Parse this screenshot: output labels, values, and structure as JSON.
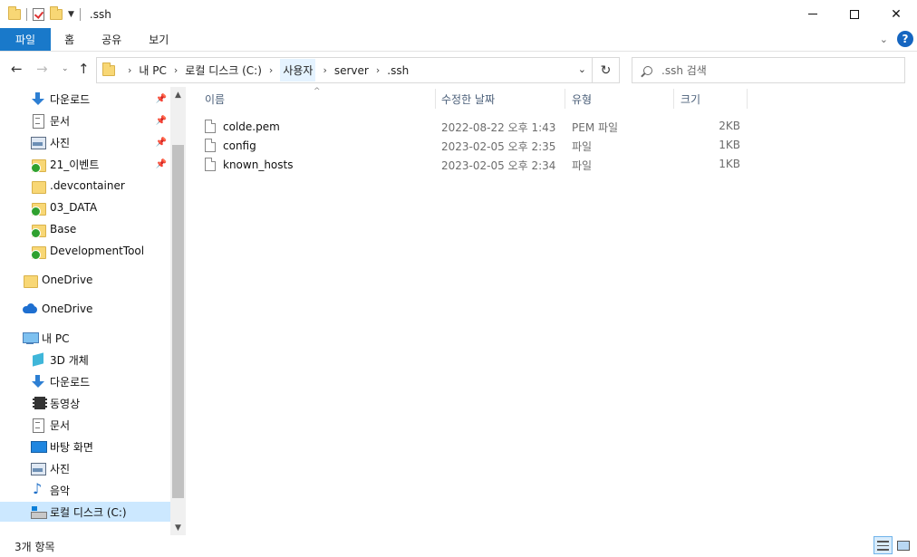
{
  "window": {
    "title": ".ssh",
    "minimize_label": "",
    "close_label": "✕"
  },
  "ribbon": {
    "tabs": [
      "파일",
      "홈",
      "공유",
      "보기"
    ],
    "help_label": "?"
  },
  "address": {
    "crumbs": [
      "내 PC",
      "로컬 디스크 (C:)",
      "사용자",
      "server",
      ".ssh"
    ],
    "search_placeholder": ".ssh 검색"
  },
  "nav": {
    "items": [
      {
        "label": "다운로드",
        "icon": "download-icon",
        "pinned": true
      },
      {
        "label": "문서",
        "icon": "document-icon",
        "pinned": true
      },
      {
        "label": "사진",
        "icon": "picture-icon",
        "pinned": true
      },
      {
        "label": "21_이벤트",
        "icon": "synced-folder-icon",
        "pinned": true
      },
      {
        "label": ".devcontainer",
        "icon": "folder-icon",
        "pinned": false
      },
      {
        "label": "03_DATA",
        "icon": "synced-folder-icon",
        "pinned": false
      },
      {
        "label": "Base",
        "icon": "synced-folder-icon",
        "pinned": false
      },
      {
        "label": "DevelopmentTool",
        "icon": "synced-folder-icon",
        "pinned": false
      },
      {
        "label": "OneDrive",
        "icon": "folder-icon",
        "pinned": false
      },
      {
        "label": "OneDrive",
        "icon": "cloud-icon",
        "pinned": false
      },
      {
        "label": "내 PC",
        "icon": "computer-icon",
        "pinned": false
      },
      {
        "label": "3D 개체",
        "icon": "3d-objects-icon",
        "pinned": false
      },
      {
        "label": "다운로드",
        "icon": "download-icon",
        "pinned": false
      },
      {
        "label": "동영상",
        "icon": "video-icon",
        "pinned": false
      },
      {
        "label": "문서",
        "icon": "document-icon",
        "pinned": false
      },
      {
        "label": "바탕 화면",
        "icon": "desktop-icon",
        "pinned": false
      },
      {
        "label": "사진",
        "icon": "picture-icon",
        "pinned": false
      },
      {
        "label": "음악",
        "icon": "music-icon",
        "pinned": false
      },
      {
        "label": "로컬 디스크 (C:)",
        "icon": "drive-icon",
        "pinned": false,
        "selected": true
      }
    ]
  },
  "columns": {
    "name": "이름",
    "date": "수정한 날짜",
    "type": "유형",
    "size": "크기"
  },
  "files": [
    {
      "name": "colde.pem",
      "date": "2022-08-22 오후 1:43",
      "type": "PEM 파일",
      "size": "2KB"
    },
    {
      "name": "config",
      "date": "2023-02-05 오후 2:35",
      "type": "파일",
      "size": "1KB"
    },
    {
      "name": "known_hosts",
      "date": "2023-02-05 오후 2:34",
      "type": "파일",
      "size": "1KB"
    }
  ],
  "status": {
    "item_count": "3개 항목"
  }
}
